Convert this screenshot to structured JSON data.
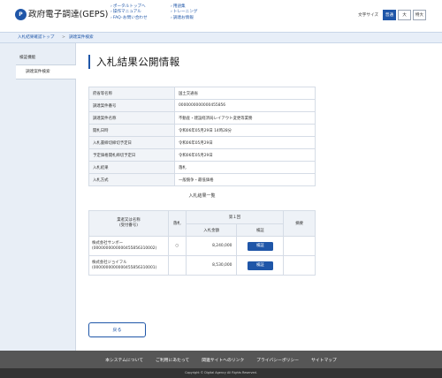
{
  "header": {
    "logo_glyph": "P",
    "brand": "政府電子調達(GEPS)",
    "links_col1": [
      "ポータルトップへ",
      "操作マニュアル",
      "FAQ･お問い合わせ"
    ],
    "links_col2": [
      "用語集",
      "トレーニング",
      "調達お情報"
    ],
    "font_size_label": "文字サイズ",
    "font_size_options": [
      "普通",
      "大",
      "特大"
    ],
    "font_size_selected": "普通"
  },
  "breadcrumb": {
    "items": [
      "入札結果確認トップ",
      "調達案件検索"
    ],
    "separator": ">"
  },
  "sidebar": {
    "heading": "検証機能",
    "items": [
      "調達案件検索"
    ]
  },
  "page_title": "入札結果公開情報",
  "details": [
    {
      "label": "府省等名称",
      "value": "国土交通省"
    },
    {
      "label": "調達案件番号",
      "value": "0000000000000455856"
    },
    {
      "label": "調達案件名称",
      "value": "不動産・建設経済局レイアウト変更等業務"
    },
    {
      "label": "開札日時",
      "value": "令和06年05月29日 14時28分"
    },
    {
      "label": "入札書締切締切予定日",
      "value": "令和06年05月29日"
    },
    {
      "label": "予定価格開札締切予定日",
      "value": "令和06年05月29日"
    },
    {
      "label": "入札結果",
      "value": "落札"
    },
    {
      "label": "入札方式",
      "value": "一般競争・最低価格"
    }
  ],
  "results": {
    "caption": "入札結果一覧",
    "headers": {
      "bidder": "業者又は名称\n(受付番号)",
      "award": "落札",
      "round": "第１回",
      "amount": "入札金額",
      "verify": "検証",
      "remarks": "摘要"
    },
    "rows": [
      {
        "name": "株式会社サンボー",
        "receipt": "(0000000000000455856310002)",
        "award": "○",
        "amount": "8,240,000",
        "verify": "検証",
        "remarks": ""
      },
      {
        "name": "株式会社ジョイフル",
        "receipt": "(0000000000000455856310001)",
        "award": "",
        "amount": "8,530,000",
        "verify": "検証",
        "remarks": ""
      }
    ]
  },
  "back_label": "戻る",
  "footer": {
    "links": [
      "本システムについて",
      "ご利用にあたって",
      "関連サイトへのリンク",
      "プライバシーポリシー",
      "サイトマップ"
    ],
    "copyright": "Copyright © Digital Agency All Rights Reserved."
  },
  "colors": {
    "accent": "#1f56a8",
    "sidebar_bg": "#e8eef6",
    "footer_bg": "#565656",
    "copyright_bg": "#333333"
  }
}
